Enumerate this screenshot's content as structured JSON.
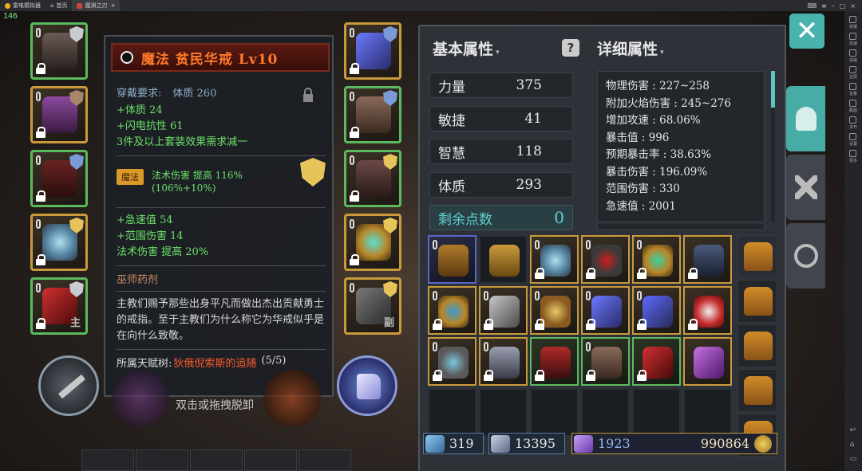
{
  "emulator": {
    "app_name": "雷电模拟器",
    "home_tab": "首页",
    "game_tab": "魔渊之刃",
    "fps": "146",
    "sidebar": [
      "按键",
      "加速",
      "减速",
      "全屏",
      "音量",
      "截图",
      "多开",
      "设置",
      "更多"
    ]
  },
  "tooltip": {
    "title": "魔法 贫民华戒 Lv10",
    "requirement_label": "穿戴要求:",
    "requirement_value": "体质 260",
    "base_attrs": [
      "+体质 24",
      "+闪电抗性 61",
      "3件及以上套装效果需求减一"
    ],
    "magic_tag": "魔法",
    "magic_effect": "法术伤害 提高 116%(106%+10%)",
    "extra_attrs": [
      "+急速值 54",
      "+范围伤害 14",
      "法术伤害 提高 20%"
    ],
    "tier": "巫师药剂",
    "lore": "主教们赐予那些出身平凡而做出杰出贡献勇士的戒指。至于主教们为什么称它为华戒似乎是在向什么致敬。",
    "talent_label": "所属天赋树:",
    "talent_value": "狄俄倪索斯的追随",
    "talent_count": "(5/5)"
  },
  "equipment_tags": {
    "main": "主",
    "sub": "副"
  },
  "drag_hint": "双击或拖拽脱卸",
  "basic_attrs": {
    "header": "基本属性",
    "help": "?",
    "stats": [
      {
        "name": "力量",
        "value": "375"
      },
      {
        "name": "敏捷",
        "value": "41"
      },
      {
        "name": "智慧",
        "value": "118"
      },
      {
        "name": "体质",
        "value": "293"
      }
    ],
    "remaining_label": "剩余点数",
    "remaining_value": "0"
  },
  "detail_attrs": {
    "header": "详细属性",
    "lines": [
      "物理伤害 : 227~258",
      "附加火焰伤害 : 245~276",
      "增加攻速 : 68.06%",
      "暴击值 : 996",
      "预期暴击率 : 38.63%",
      "暴击伤害 : 196.09%",
      "范围伤害 : 330",
      "急速值 : 2001"
    ]
  },
  "currency": {
    "keys": "319",
    "crystals": "13395",
    "gems": "1923",
    "gold": "990864"
  },
  "colors": {
    "accent": "#48aca6",
    "title_orange": "#ff7a2a",
    "stat_green": "#6de36a",
    "legendary_border": "#c89a3c",
    "rare_border": "#5cba5e"
  }
}
